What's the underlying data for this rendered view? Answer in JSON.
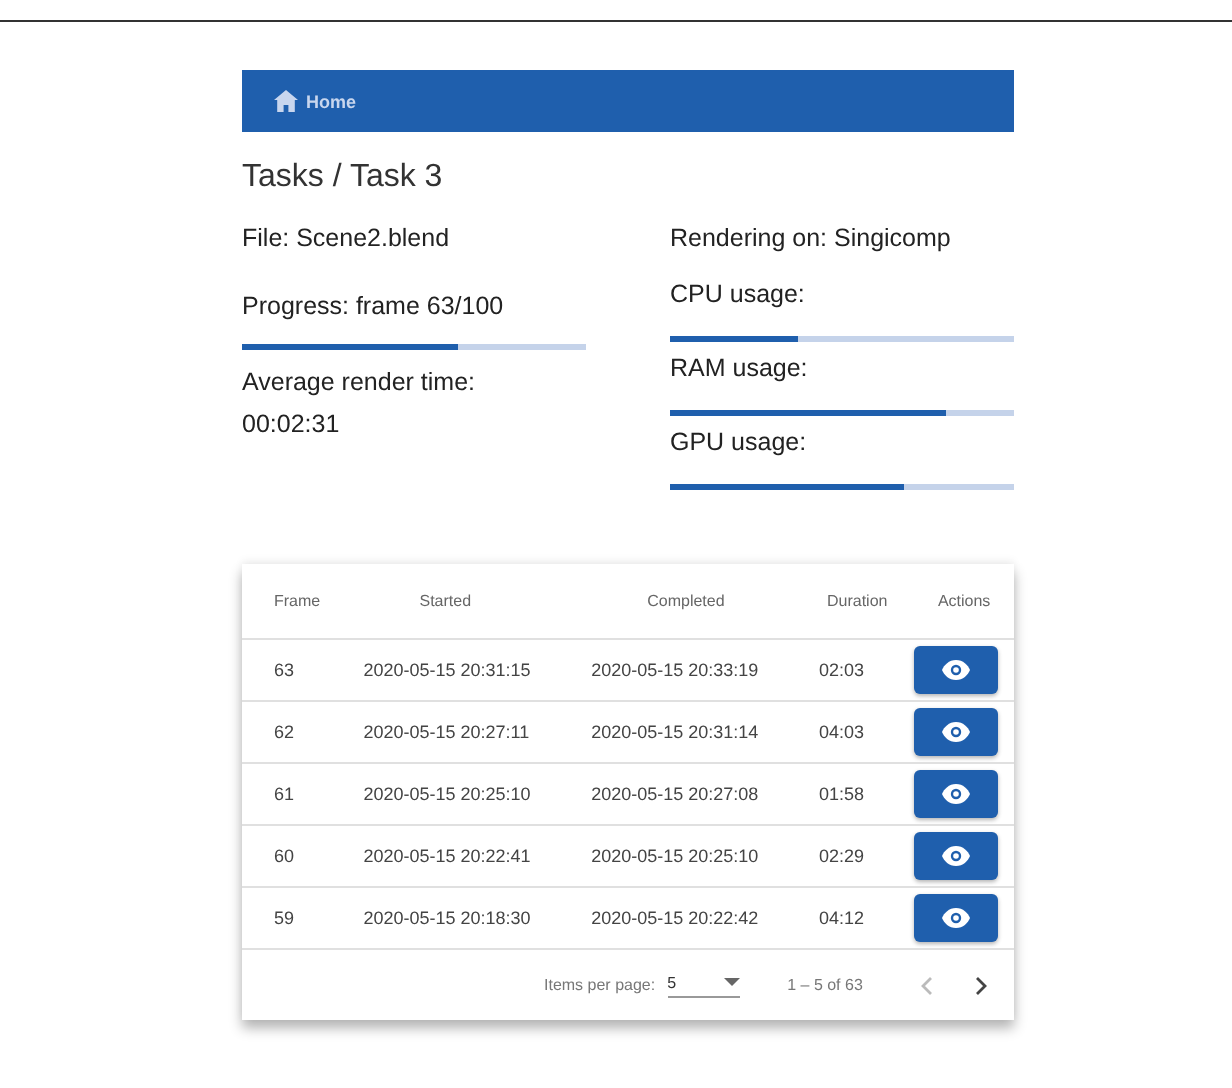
{
  "nav": {
    "home_label": "Home"
  },
  "title": "Tasks / Task 3",
  "file": "File: Scene2.blend",
  "progress": {
    "label": "Progress: frame 63/100",
    "level": 0.63
  },
  "average": {
    "label": "Average render time:",
    "value": "00:02:31"
  },
  "rendering_on": "Rendering on: Singicomp",
  "usages": [
    {
      "label": "CPU usage:",
      "level": 0.37
    },
    {
      "label": "RAM usage:",
      "level": 0.8
    },
    {
      "label": "GPU usage:",
      "level": 0.68
    }
  ],
  "table": {
    "columns": [
      "Frame",
      "Started",
      "Completed",
      "Duration",
      "Actions"
    ],
    "rows": [
      {
        "frame": "63",
        "started": "2020-05-15 20:31:15",
        "completed": "2020-05-15 20:33:19",
        "duration": "02:03"
      },
      {
        "frame": "62",
        "started": "2020-05-15 20:27:11",
        "completed": "2020-05-15 20:31:14",
        "duration": "04:03"
      },
      {
        "frame": "61",
        "started": "2020-05-15 20:25:10",
        "completed": "2020-05-15 20:27:08",
        "duration": "01:58"
      },
      {
        "frame": "60",
        "started": "2020-05-15 20:22:41",
        "completed": "2020-05-15 20:25:10",
        "duration": "02:29"
      },
      {
        "frame": "59",
        "started": "2020-05-15 20:18:30",
        "completed": "2020-05-15 20:22:42",
        "duration": "04:12"
      }
    ]
  },
  "paginator": {
    "items_label": "Items per page:",
    "page_size": "5",
    "range": "1 – 5 of 63",
    "prev_disabled": true,
    "next_disabled": false
  }
}
